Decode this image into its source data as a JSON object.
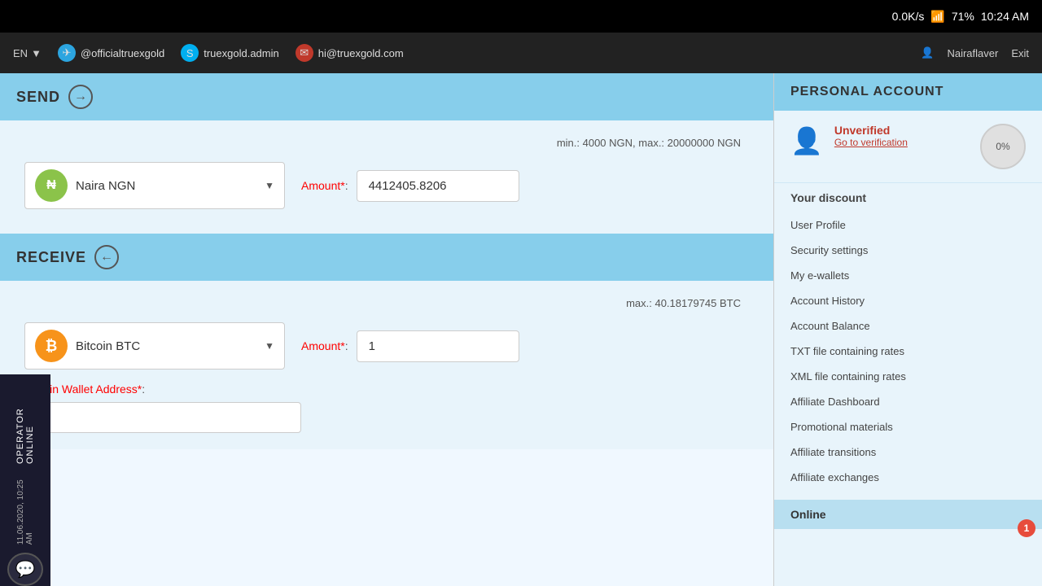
{
  "statusBar": {
    "speed": "0.0K/s",
    "battery": "71%",
    "time": "10:24 AM"
  },
  "navBar": {
    "lang": "EN",
    "contacts": [
      {
        "icon": "telegram",
        "handle": "@officialtruexgold"
      },
      {
        "icon": "skype",
        "handle": "truexgold.admin"
      },
      {
        "icon": "email",
        "handle": "hi@truexgold.com"
      }
    ],
    "user": "Nairaflaver",
    "exit": "Exit"
  },
  "sendSection": {
    "label": "SEND",
    "limit": "min.: 4000 NGN, max.: 20000000 NGN",
    "currency": "Naira NGN",
    "amountLabel": "Amount",
    "amountValue": "4412405.8206"
  },
  "receiveSection": {
    "label": "RECEIVE",
    "limit": "max.: 40.18179745 BTC",
    "currency": "Bitcoin BTC",
    "amountLabel": "Amount",
    "amountValue": "1",
    "walletLabel": "Bitcoin Wallet Address",
    "walletValue": ""
  },
  "rightPanel": {
    "title": "PERSONAL ACCOUNT",
    "verification": {
      "status": "Unverified",
      "link": "Go to verification"
    },
    "discount": {
      "label": "Your discount",
      "percent": "0%"
    },
    "navItems": [
      "User Profile",
      "Security settings",
      "My e-wallets",
      "Account History",
      "Account Balance",
      "TXT file containing rates",
      "XML file containing rates",
      "Affiliate Dashboard",
      "Promotional materials",
      "Affiliate transitions",
      "Affiliate exchanges"
    ],
    "onlineLabel": "Online"
  },
  "operator": {
    "label": "OPERATOR ONLINE",
    "date": "11.06.2020, 10:25 AM"
  },
  "notification": {
    "count": "1"
  }
}
